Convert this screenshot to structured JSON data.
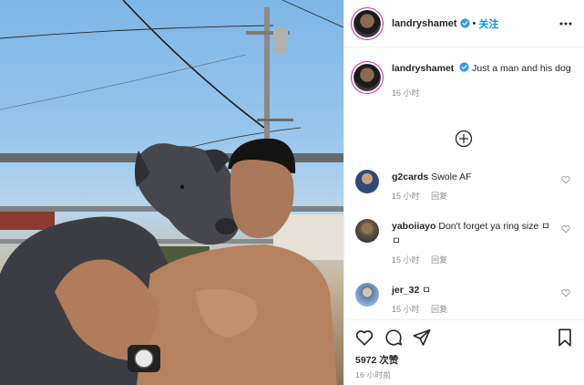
{
  "post": {
    "author": "landryshamet",
    "follow_separator": "•",
    "follow_label": "关注"
  },
  "caption": {
    "username": "landryshamet",
    "text": "Just a man and his dog",
    "time": "16 小时"
  },
  "comments": [
    {
      "username": "g2cards",
      "text": "Swole AF",
      "time": "15 小时",
      "reply": "回复",
      "avatar_color": "#2d4a7a"
    },
    {
      "username": "yaboiiayo",
      "text": "Don't forget ya ring size ㅁㅁ",
      "time": "15 小时",
      "reply": "回复",
      "avatar_color": "#6b5a45"
    },
    {
      "username": "jer_32",
      "text": "ㅁ",
      "time": "15 小时",
      "reply": "回复",
      "avatar_color": "#5a7fa8"
    }
  ],
  "footer": {
    "likes": "5972 次赞",
    "posted_ago": "16 小时前"
  },
  "icons": {
    "verified": "verified-badge-icon",
    "more": "more-options-icon",
    "load_more": "load-more-comments-icon",
    "comment_like": "heart-outline-icon",
    "like": "heart-icon",
    "comment": "comment-icon",
    "share": "paper-plane-icon",
    "save": "bookmark-icon"
  },
  "colors": {
    "accent": "#0095f6",
    "verified": "#3897f0",
    "secondary_text": "#8e8e8e",
    "story_ring": "#d6249f"
  }
}
